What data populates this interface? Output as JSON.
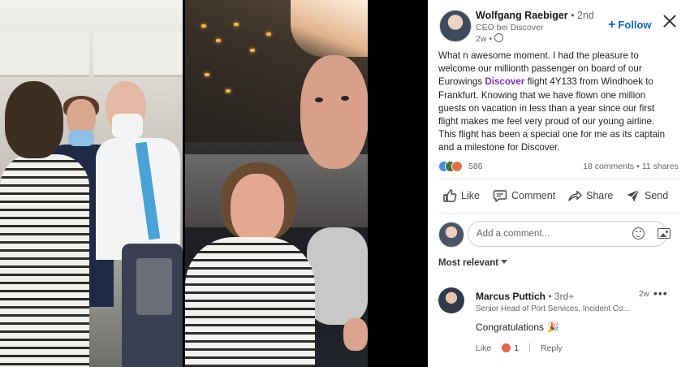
{
  "post": {
    "author": {
      "name": "Wolfgang Raebiger",
      "degree": "• 2nd",
      "title": "CEO bei Discover",
      "time": "2w •"
    },
    "follow_label": "Follow",
    "text_lines": [
      "What n awesome moment. I had the pleasure to",
      "welcome our millionth passenger on board of our",
      "flight 4Y133 from Windhoek to",
      "Frankfurt. Knowing that we have flown one million",
      "guests on vacation in less than a year since our first",
      "flight makes me feel very proud of our young airline.",
      "This flight has been a special one for me as its captain",
      "and a milestone for Discover."
    ],
    "text_line3_prefix": "Eurowings ",
    "text_highlight": "Discover",
    "text_line3_suffix": " flight 4Y133 from Windhoek to",
    "reaction_count": "586",
    "stats": "18 comments • 11 shares",
    "actions": {
      "like": "Like",
      "comment": "Comment",
      "share": "Share",
      "send": "Send"
    }
  },
  "comment_box": {
    "placeholder": "Add a comment..."
  },
  "sort_label": "Most relevant",
  "comments": [
    {
      "name": "Marcus Puttich",
      "degree": "• 3rd+",
      "headline": "Senior Head of Port Services, Incident Co...",
      "time": "2w",
      "more": "•••",
      "text": "Congratulations",
      "like_label": "Like",
      "like_count": "1",
      "reply_label": "Reply"
    }
  ],
  "colors": {
    "brand_blue": "#0a66c2",
    "highlight_purple": "#7b2ccb",
    "text_dark": "#191919",
    "text_muted": "#666666"
  }
}
